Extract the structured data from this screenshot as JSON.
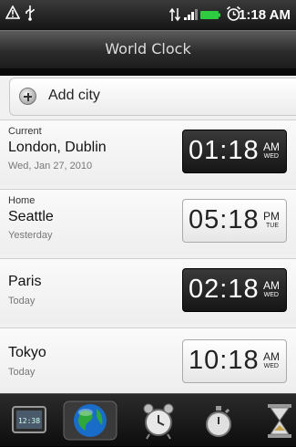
{
  "status_bar": {
    "time": "1:18 AM",
    "icons": [
      "warning-icon",
      "usb-icon",
      "data-arrows-icon",
      "signal-icon",
      "battery-icon",
      "alarm-icon"
    ]
  },
  "header": {
    "title": "World Clock"
  },
  "add_city": {
    "label": "Add city",
    "icon": "plus-icon"
  },
  "cities": [
    {
      "tag": "Current",
      "name": "London, Dublin",
      "sub": "Wed, Jan 27, 2010",
      "time": "01:18",
      "ampm": "AM",
      "day": "WED",
      "style": "dark"
    },
    {
      "tag": "Home",
      "name": "Seattle",
      "sub": "Yesterday",
      "time": "05:18",
      "ampm": "PM",
      "day": "TUE",
      "style": "light"
    },
    {
      "tag": "",
      "name": "Paris",
      "sub": "Today",
      "time": "02:18",
      "ampm": "AM",
      "day": "WED",
      "style": "dark"
    },
    {
      "tag": "",
      "name": "Tokyo",
      "sub": "Today",
      "time": "10:18",
      "ampm": "AM",
      "day": "WED",
      "style": "light"
    }
  ],
  "tabs": [
    {
      "name": "desk-clock",
      "icon": "desk-clock-icon",
      "clock_text": "12:38"
    },
    {
      "name": "world-clock",
      "icon": "globe-icon",
      "active": true
    },
    {
      "name": "alarms",
      "icon": "alarm-clock-icon"
    },
    {
      "name": "stopwatch",
      "icon": "stopwatch-icon"
    },
    {
      "name": "timer",
      "icon": "hourglass-icon"
    }
  ],
  "colors": {
    "dark_clock": "#1f1f1f",
    "light_clock": "#f4f4f4",
    "battery": "#2ecc40"
  }
}
